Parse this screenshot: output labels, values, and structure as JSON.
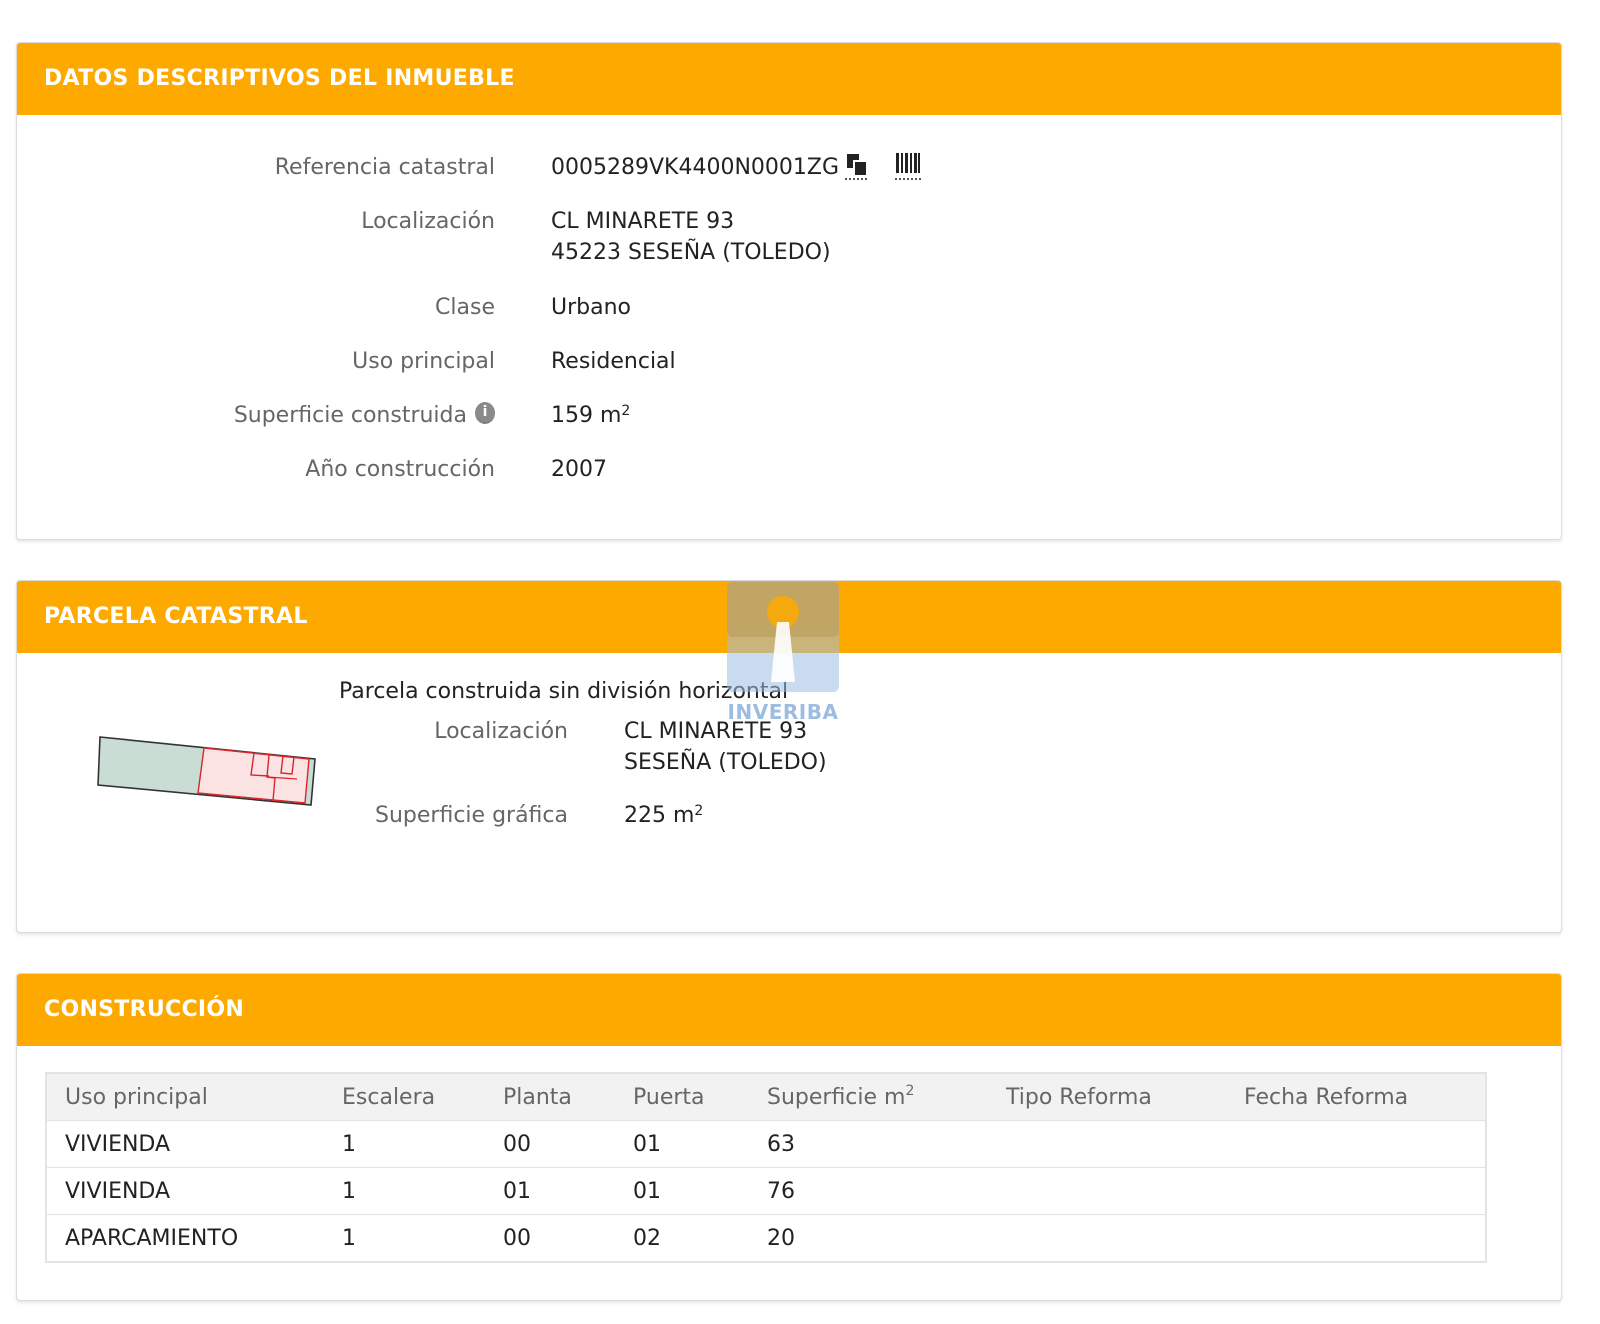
{
  "descriptive": {
    "title": "DATOS DESCRIPTIVOS DEL INMUEBLE",
    "ref_label": "Referencia catastral",
    "ref_value": "0005289VK4400N0001ZG",
    "loc_label": "Localización",
    "loc_line1": "CL MINARETE 93",
    "loc_line2": "45223 SESEÑA (TOLEDO)",
    "class_label": "Clase",
    "class_value": "Urbano",
    "use_label": "Uso principal",
    "use_value": "Residencial",
    "area_label": "Superficie construida",
    "area_value": "159 m",
    "area_unit_exp": "2",
    "year_label": "Año construcción",
    "year_value": "2007"
  },
  "parcel": {
    "title": "PARCELA CATASTRAL",
    "subtitle": "Parcela construida sin división horizontal",
    "loc_label": "Localización",
    "loc_line1": "CL MINARETE 93",
    "loc_line2": "SESEÑA (TOLEDO)",
    "area_label": "Superficie gráfica",
    "area_value": "225 m",
    "area_unit_exp": "2"
  },
  "watermark": {
    "text": "INVERIBA"
  },
  "construction": {
    "title": "CONSTRUCCIÓN",
    "columns": [
      "Uso principal",
      "Escalera",
      "Planta",
      "Puerta",
      "Superficie m",
      "Tipo Reforma",
      "Fecha Reforma"
    ],
    "area_unit_exp": "2",
    "rows": [
      [
        "VIVIENDA",
        "1",
        "00",
        "01",
        "63",
        "",
        ""
      ],
      [
        "VIVIENDA",
        "1",
        "01",
        "01",
        "76",
        "",
        ""
      ],
      [
        "APARCAMIENTO",
        "1",
        "00",
        "02",
        "20",
        "",
        ""
      ]
    ]
  },
  "colors": {
    "header_orange": "#fea900",
    "label_grey": "#666666",
    "parcel_green": "#c9ddd5",
    "parcel_pink": "#fbe3e3",
    "parcel_red_line": "#d9262b",
    "watermark_blue": "#9dbde0"
  },
  "icons": {
    "copy": "copy-icon",
    "barcode": "barcode-icon",
    "info": "info-icon"
  }
}
